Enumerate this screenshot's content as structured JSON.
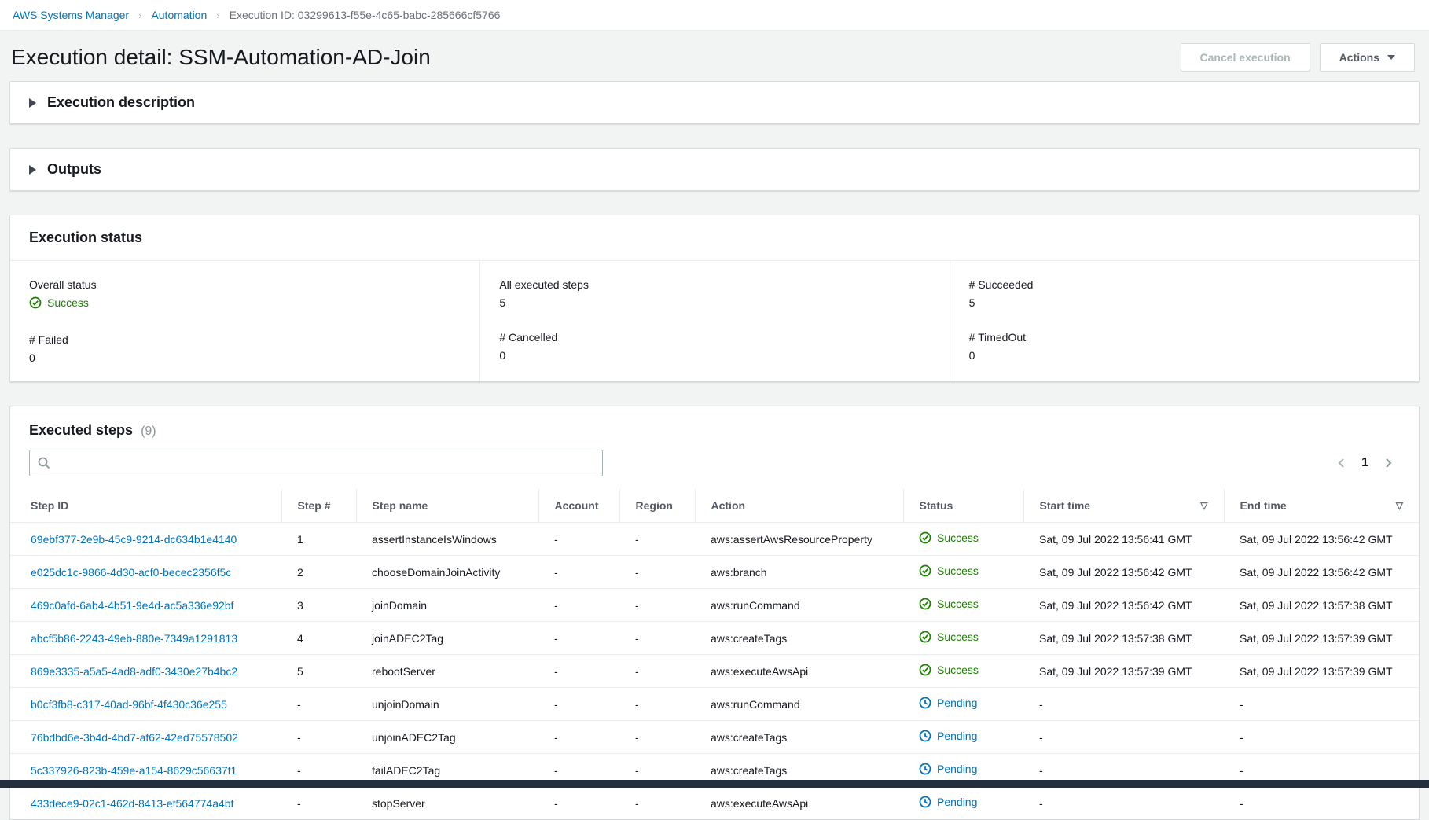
{
  "colors": {
    "success": "#1d8102",
    "pending": "#0073bb",
    "link": "#0073bb",
    "footer_dark": "#232f3e"
  },
  "breadcrumb": {
    "item1": "AWS Systems Manager",
    "item2": "Automation",
    "item3": "Execution ID: 03299613-f55e-4c65-babc-285666cf5766"
  },
  "header": {
    "title": "Execution detail: SSM-Automation-AD-Join",
    "cancel_button_label": "Cancel execution",
    "actions_button_label": "Actions"
  },
  "collapsibles": {
    "execution_description_label": "Execution description",
    "outputs_label": "Outputs"
  },
  "execution_status": {
    "title": "Execution status",
    "overall_status": {
      "label": "Overall status",
      "value": "Success"
    },
    "all_executed_steps": {
      "label": "All executed steps",
      "value": "5"
    },
    "succeeded": {
      "label": "# Succeeded",
      "value": "5"
    },
    "failed": {
      "label": "# Failed",
      "value": "0"
    },
    "cancelled": {
      "label": "# Cancelled",
      "value": "0"
    },
    "timedout": {
      "label": "# TimedOut",
      "value": "0"
    }
  },
  "executed_steps": {
    "title": "Executed steps",
    "count": "(9)",
    "search_placeholder": "",
    "pagination": {
      "current_page": "1"
    },
    "columns": [
      "Step ID",
      "Step #",
      "Step name",
      "Account",
      "Region",
      "Action",
      "Status",
      "Start time",
      "End time"
    ],
    "rows": [
      {
        "step_id": "69ebf377-2e9b-45c9-9214-dc634b1e4140",
        "step_num": "1",
        "step_name": "assertInstanceIsWindows",
        "account": "-",
        "region": "-",
        "action": "aws:assertAwsResourceProperty",
        "status": "Success",
        "status_type": "success",
        "start_time": "Sat, 09 Jul 2022 13:56:41 GMT",
        "end_time": "Sat, 09 Jul 2022 13:56:42 GMT"
      },
      {
        "step_id": "e025dc1c-9866-4d30-acf0-becec2356f5c",
        "step_num": "2",
        "step_name": "chooseDomainJoinActivity",
        "account": "-",
        "region": "-",
        "action": "aws:branch",
        "status": "Success",
        "status_type": "success",
        "start_time": "Sat, 09 Jul 2022 13:56:42 GMT",
        "end_time": "Sat, 09 Jul 2022 13:56:42 GMT"
      },
      {
        "step_id": "469c0afd-6ab4-4b51-9e4d-ac5a336e92bf",
        "step_num": "3",
        "step_name": "joinDomain",
        "account": "-",
        "region": "-",
        "action": "aws:runCommand",
        "status": "Success",
        "status_type": "success",
        "start_time": "Sat, 09 Jul 2022 13:56:42 GMT",
        "end_time": "Sat, 09 Jul 2022 13:57:38 GMT"
      },
      {
        "step_id": "abcf5b86-2243-49eb-880e-7349a1291813",
        "step_num": "4",
        "step_name": "joinADEC2Tag",
        "account": "-",
        "region": "-",
        "action": "aws:createTags",
        "status": "Success",
        "status_type": "success",
        "start_time": "Sat, 09 Jul 2022 13:57:38 GMT",
        "end_time": "Sat, 09 Jul 2022 13:57:39 GMT"
      },
      {
        "step_id": "869e3335-a5a5-4ad8-adf0-3430e27b4bc2",
        "step_num": "5",
        "step_name": "rebootServer",
        "account": "-",
        "region": "-",
        "action": "aws:executeAwsApi",
        "status": "Success",
        "status_type": "success",
        "start_time": "Sat, 09 Jul 2022 13:57:39 GMT",
        "end_time": "Sat, 09 Jul 2022 13:57:39 GMT"
      },
      {
        "step_id": "b0cf3fb8-c317-40ad-96bf-4f430c36e255",
        "step_num": "-",
        "step_name": "unjoinDomain",
        "account": "-",
        "region": "-",
        "action": "aws:runCommand",
        "status": "Pending",
        "status_type": "pending",
        "start_time": "-",
        "end_time": "-"
      },
      {
        "step_id": "76bdbd6e-3b4d-4bd7-af62-42ed75578502",
        "step_num": "-",
        "step_name": "unjoinADEC2Tag",
        "account": "-",
        "region": "-",
        "action": "aws:createTags",
        "status": "Pending",
        "status_type": "pending",
        "start_time": "-",
        "end_time": "-"
      },
      {
        "step_id": "5c337926-823b-459e-a154-8629c56637f1",
        "step_num": "-",
        "step_name": "failADEC2Tag",
        "account": "-",
        "region": "-",
        "action": "aws:createTags",
        "status": "Pending",
        "status_type": "pending",
        "start_time": "-",
        "end_time": "-"
      },
      {
        "step_id": "433dece9-02c1-462d-8413-ef564774a4bf",
        "step_num": "-",
        "step_name": "stopServer",
        "account": "-",
        "region": "-",
        "action": "aws:executeAwsApi",
        "status": "Pending",
        "status_type": "pending",
        "start_time": "-",
        "end_time": "-"
      }
    ]
  }
}
